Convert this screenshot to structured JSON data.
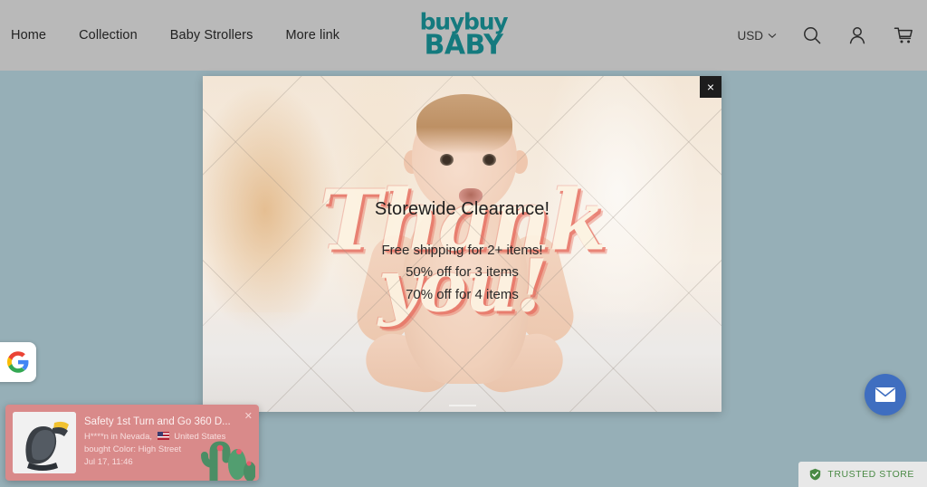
{
  "header": {
    "nav": [
      {
        "label": "Home"
      },
      {
        "label": "Collection"
      },
      {
        "label": "Baby Strollers"
      },
      {
        "label": "More link"
      }
    ],
    "logo": {
      "line1": "buybuy",
      "line2": "BABY",
      "color": "#147a7e"
    },
    "currency": {
      "value": "USD",
      "caret": "⌄"
    },
    "icons": [
      {
        "name": "search-icon"
      },
      {
        "name": "account-icon"
      },
      {
        "name": "cart-icon"
      }
    ],
    "background_color": "#b9b9b9"
  },
  "modal": {
    "title": "Storewide Clearance!",
    "lines": [
      "Free shipping for 2+ items!",
      "50% off for 3 items",
      "70% off for 4 items"
    ],
    "watermark": {
      "line1": "Thank",
      "line2": "you!"
    },
    "close_label": "×"
  },
  "google_badge": {
    "name": "google-g-logo",
    "letter": "G"
  },
  "notification": {
    "product_title": "Safety 1st Turn and Go 360 D...",
    "buyer_line": "H****n in Nevada,",
    "country": "United States",
    "variant_line": "bought Color: High Street",
    "timestamp": "Jul 17, 11:46",
    "close_label": "✕",
    "background_color": "#d98a8a"
  },
  "chat_button": {
    "name": "email-chat-icon",
    "color": "#3f6ec0"
  },
  "trusted_store": {
    "label": "TRUSTED STORE",
    "accent_color": "#4a8a45"
  },
  "page": {
    "background_color": "#96afb7"
  }
}
